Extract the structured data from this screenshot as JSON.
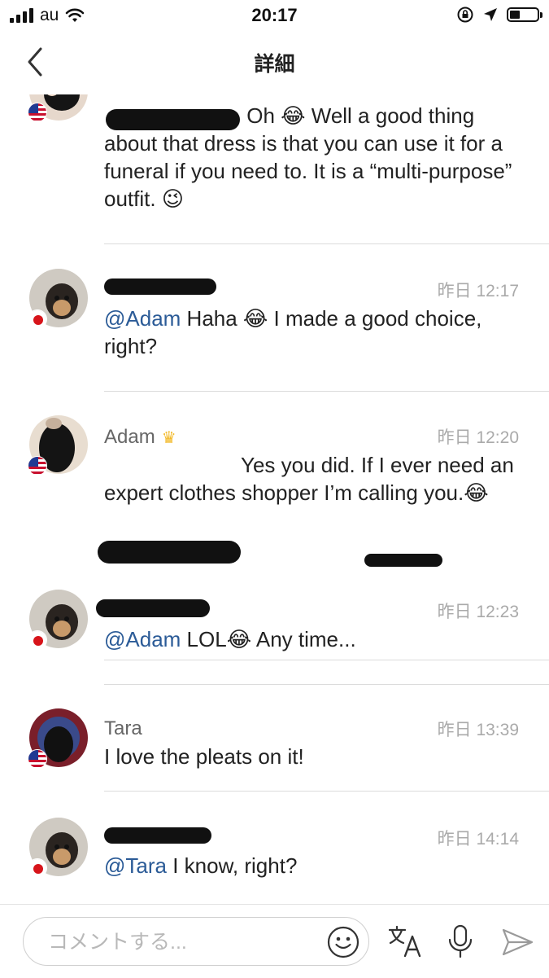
{
  "status_bar": {
    "carrier": "au",
    "time": "20:17"
  },
  "nav": {
    "title": "詳細"
  },
  "comments": [
    {
      "author": "",
      "time": "",
      "mention": "",
      "text": "Oh 😂 Well a good thing about that dress is that you can use it for a funeral if you need to. It is a “multi-purpose” outfit. 😉",
      "flag": "us"
    },
    {
      "author": "",
      "time": "昨日 12:17",
      "mention": "@Adam",
      "text": " Haha 😂 I made a good choice, right?",
      "flag": "jp"
    },
    {
      "author": "Adam",
      "time": "昨日 12:20",
      "mention": "",
      "text": "Yes you did. If I ever need an expert clothes shopper I’m calling you.😂",
      "flag": "us",
      "badge": "crown-icon"
    },
    {
      "author": "",
      "time": "昨日 12:23",
      "mention": "@Adam",
      "text": " LOL😂 Any time...",
      "flag": "jp"
    },
    {
      "author": "Tara",
      "time": "昨日 13:39",
      "mention": "",
      "text": "I love the pleats on it!",
      "flag": "us"
    },
    {
      "author": "",
      "time": "昨日 14:14",
      "mention": "@Tara",
      "text": " I know, right?",
      "flag": "jp"
    }
  ],
  "composer": {
    "placeholder": "コメントする..."
  },
  "colors": {
    "mention": "#2b5b97",
    "timestamp": "#aaaaaa",
    "divider": "#dcdcdc",
    "crown": "#f2b824"
  },
  "icons": [
    "back-chevron-icon",
    "emoji-icon",
    "translate-icon",
    "microphone-icon",
    "send-icon"
  ]
}
